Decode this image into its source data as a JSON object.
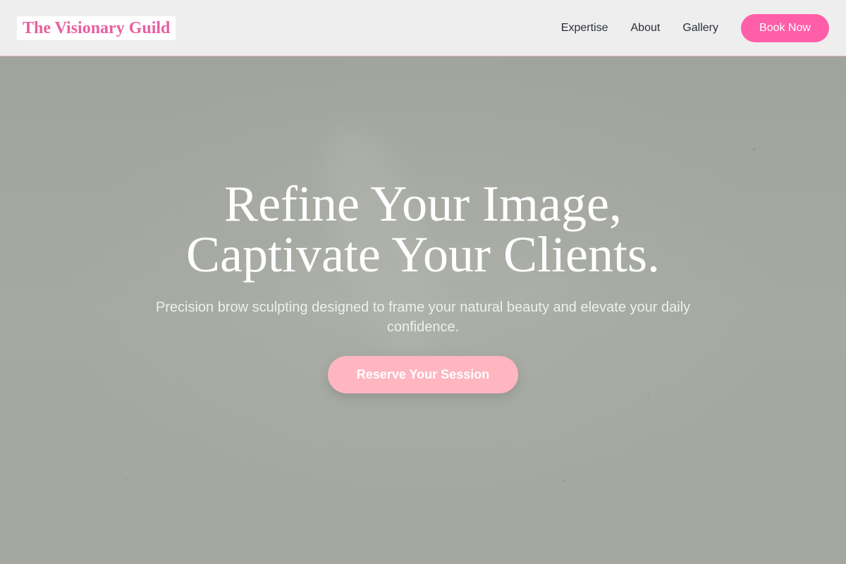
{
  "header": {
    "logo_text": "The Visionary Guild",
    "nav": [
      {
        "label": "Expertise"
      },
      {
        "label": "About"
      },
      {
        "label": "Gallery"
      }
    ],
    "book_label": "Book Now"
  },
  "hero": {
    "title_line1": "Refine Your Image,",
    "title_line2": "Captivate Your Clients.",
    "subtitle": "Precision brow sculpting designed to frame your natural beauty and elevate your daily confidence.",
    "cta_label": "Reserve Your Session"
  },
  "colors": {
    "brand_pink": "#e85fa0",
    "button_pink": "#ff5fa8",
    "cta_pink": "#ffb6c1",
    "header_bg": "#eeeeee",
    "hero_bg": "#a4a8a0"
  }
}
